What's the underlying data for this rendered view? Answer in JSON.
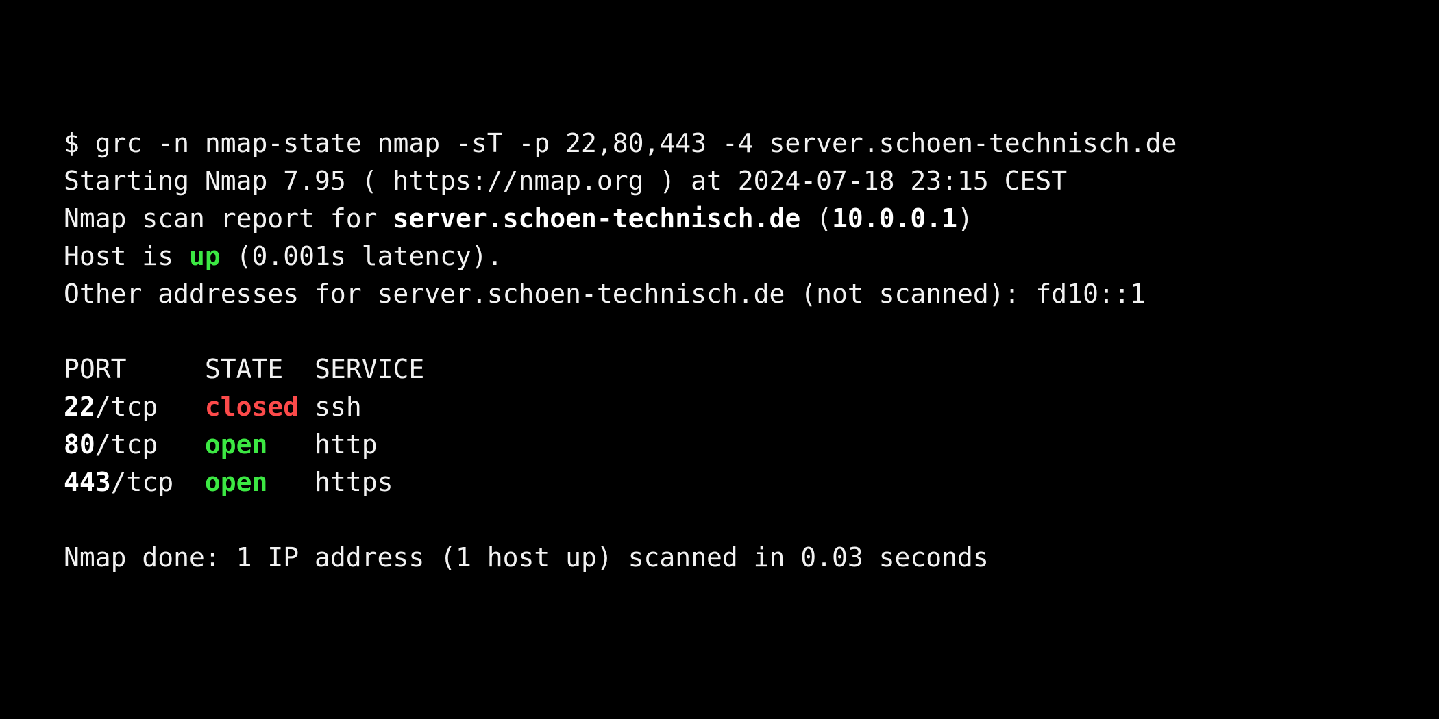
{
  "terminal": {
    "background_color": "#000000",
    "foreground_color": "#f2f2f2",
    "bold_color": "#ffffff",
    "open_color": "#3ce843",
    "closed_color": "#fc4a4a",
    "prompt_symbol": "$",
    "command": "grc -n nmap-state nmap -sT -p 22,80,443 -4 server.schoen-technisch.de"
  },
  "output": {
    "banner": "Starting Nmap 7.95 ( https://nmap.org ) at 2024-07-18 23:15 CEST",
    "report_prefix": "Nmap scan report for ",
    "report_host": "server.schoen-technisch.de",
    "report_open_paren": " (",
    "report_ip": "10.0.0.1",
    "report_close_paren": ")",
    "host_status_prefix": "Host is ",
    "host_status": "up",
    "host_status_suffix": " (0.001s latency).",
    "other_addresses": "Other addresses for server.schoen-technisch.de (not scanned): fd10::1",
    "summary": "Nmap done: 1 IP address (1 host up) scanned in 0.03 seconds"
  },
  "port_table": {
    "headers": {
      "port": "PORT",
      "port_pad": "     ",
      "state": "STATE",
      "state_pad": "  ",
      "service": "SERVICE"
    },
    "rows": [
      {
        "port_number": "22",
        "port_proto": "/tcp",
        "port_pad": "   ",
        "state": "closed",
        "state_kind": "closed",
        "state_pad": " ",
        "service": "ssh"
      },
      {
        "port_number": "80",
        "port_proto": "/tcp",
        "port_pad": "   ",
        "state": "open",
        "state_kind": "open",
        "state_pad": "   ",
        "service": "http"
      },
      {
        "port_number": "443",
        "port_proto": "/tcp",
        "port_pad": "  ",
        "state": "open",
        "state_kind": "open",
        "state_pad": "   ",
        "service": "https"
      }
    ]
  }
}
